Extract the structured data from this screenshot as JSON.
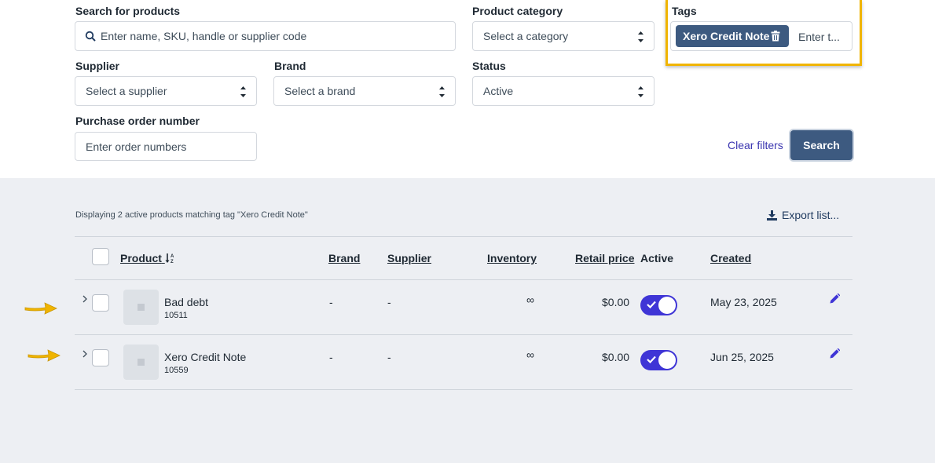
{
  "filters": {
    "search": {
      "label": "Search for products",
      "placeholder": "Enter name, SKU, handle or supplier code"
    },
    "category": {
      "label": "Product category",
      "value": "Select a category"
    },
    "tags": {
      "label": "Tags",
      "chip": "Xero Credit Note",
      "input_placeholder": "Enter t..."
    },
    "supplier": {
      "label": "Supplier",
      "value": "Select a supplier"
    },
    "brand": {
      "label": "Brand",
      "value": "Select a brand"
    },
    "status": {
      "label": "Status",
      "value": "Active"
    },
    "po": {
      "label": "Purchase order number",
      "placeholder": "Enter order numbers"
    },
    "clear_label": "Clear filters",
    "search_label": "Search"
  },
  "results": {
    "summary": "Displaying 2 active products matching tag \"Xero Credit Note\"",
    "export_label": "Export list...",
    "columns": {
      "product": "Product",
      "brand": "Brand",
      "supplier": "Supplier",
      "inventory": "Inventory",
      "retail_price": "Retail price",
      "active": "Active",
      "created": "Created"
    },
    "rows": [
      {
        "name": "Bad debt",
        "sku": "10511",
        "brand": "-",
        "supplier": "-",
        "inventory": "∞",
        "price": "$0.00",
        "active": true,
        "created": "May 23, 2025"
      },
      {
        "name": "Xero Credit Note",
        "sku": "10559",
        "brand": "-",
        "supplier": "-",
        "inventory": "∞",
        "price": "$0.00",
        "active": true,
        "created": "Jun 25, 2025"
      }
    ]
  },
  "colors": {
    "primary": "#3d5a80",
    "toggle": "#3f35d6",
    "highlight": "#f0b400",
    "link": "#3a35b0"
  },
  "icons": [
    "search-icon",
    "updown-icon",
    "trash-icon",
    "download-icon",
    "sort-icon",
    "chevron-right-icon",
    "image-placeholder-icon",
    "check-icon",
    "pencil-icon",
    "arrow-annotation-icon"
  ]
}
